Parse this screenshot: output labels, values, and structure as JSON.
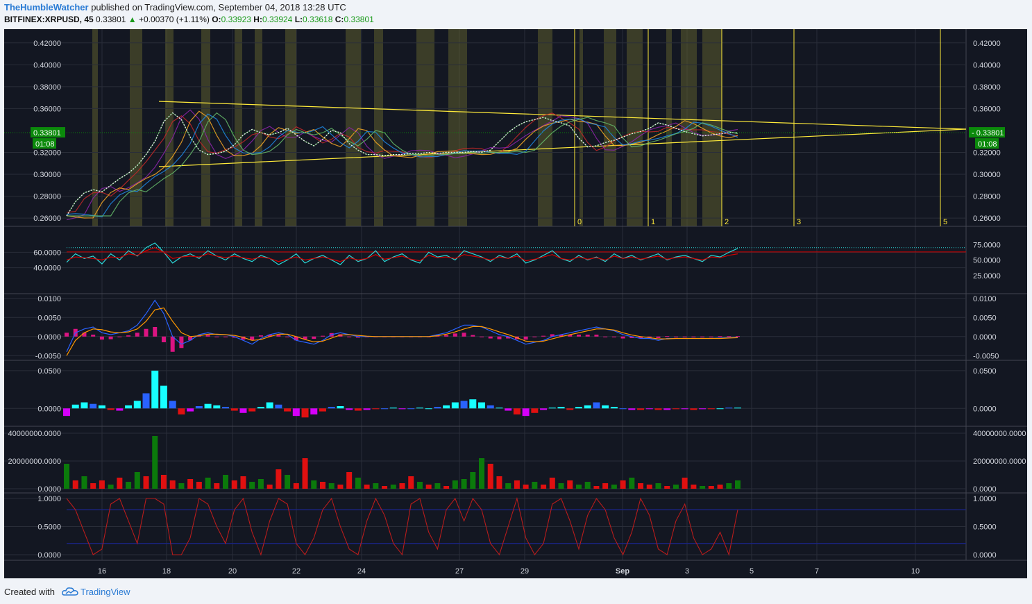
{
  "header": {
    "author": "TheHumbleWatcher",
    "published_text": " published on TradingView.com, September 04, 2018 13:28 UTC",
    "symbol": "BITFINEX:XRPUSD, 45",
    "last": "0.33801",
    "change": "+0.00370 (+1.11%)",
    "o_label": "O:",
    "o_value": "0.33923",
    "h_label": "H:",
    "h_value": "0.33924",
    "l_label": "L:",
    "l_value": "0.33618",
    "c_label": "C:",
    "c_value": "0.33801"
  },
  "footer": {
    "created_with": "Created with",
    "brand": "TradingView"
  },
  "colors": {
    "background": "#131722",
    "grid": "#2a2e39",
    "trendline": "#ffeb3b",
    "highlight_band": "#5c5c2e",
    "price_tag": "#0b8a0b",
    "rsi": "#2bd6d6",
    "rsi_signal": "#d40000",
    "macd": "#2962ff",
    "macd_signal": "#ff9800",
    "macd_hist": "#ff1493",
    "volume_up": "#0b7a0b",
    "volume_down": "#e01010",
    "stoch": "#b71c1c",
    "stoch_bands": "#1a237e"
  },
  "icons": {
    "brand_logo": "tradingview-cloud-icon",
    "trend_arrow": "triangle-up-icon"
  },
  "chart_data": [
    {
      "type": "line",
      "title": "BITFINEX:XRPUSD, 45",
      "x_ticks": [
        "16",
        "18",
        "20",
        "22",
        "24",
        "27",
        "29",
        "Sep",
        "3",
        "5",
        "7",
        "10"
      ],
      "y_ticks": [
        "0.26000",
        "0.28000",
        "0.30000",
        "0.32000",
        "0.36000",
        "0.38000",
        "0.40000",
        "0.42000"
      ],
      "ylim": [
        0.255,
        0.43
      ],
      "series": [
        {
          "values": [
            0.262,
            0.275,
            0.283,
            0.286,
            0.284,
            0.29,
            0.296,
            0.301,
            0.308,
            0.318,
            0.33,
            0.348,
            0.356,
            0.35,
            0.334,
            0.322,
            0.318,
            0.319,
            0.321,
            0.327,
            0.336,
            0.341,
            0.338,
            0.336,
            0.338,
            0.342,
            0.336,
            0.33,
            0.326,
            0.332,
            0.34,
            0.338,
            0.328,
            0.322,
            0.318,
            0.318,
            0.317,
            0.318,
            0.318,
            0.319,
            0.319,
            0.32,
            0.319,
            0.32,
            0.32,
            0.32,
            0.321,
            0.32,
            0.322,
            0.33,
            0.338,
            0.344,
            0.348,
            0.35,
            0.352,
            0.349,
            0.347,
            0.344,
            0.333,
            0.325,
            0.326,
            0.329,
            0.331,
            0.334,
            0.337,
            0.339,
            0.342,
            0.347,
            0.345,
            0.342,
            0.339,
            0.337,
            0.335,
            0.336,
            0.337,
            0.338,
            0.338
          ]
        }
      ],
      "volume_axis_labels": [
        "0",
        "1",
        "2",
        "3",
        "5"
      ],
      "last_price_tag": "0.33801",
      "countdown_tag": "01:08",
      "grid": true
    },
    {
      "type": "line",
      "name": "RSI",
      "y_ticks_left": [
        "40.0000",
        "60.0000"
      ],
      "y_ticks_right": [
        "25.0000",
        "50.0000",
        "75.0000"
      ],
      "ylim": [
        10,
        90
      ],
      "series": [
        {
          "values": [
            47,
            58,
            52,
            55,
            45,
            58,
            50,
            62,
            55,
            66,
            72,
            60,
            46,
            54,
            58,
            52,
            62,
            55,
            50,
            58,
            52,
            48,
            56,
            52,
            44,
            50,
            58,
            46,
            52,
            56,
            50,
            44,
            56,
            48,
            52,
            62,
            48,
            54,
            58,
            50,
            46,
            60,
            54,
            56,
            50,
            62,
            58,
            54,
            48,
            56,
            52,
            58,
            46,
            50,
            56,
            62,
            52,
            48,
            56,
            50,
            54,
            48,
            58,
            52,
            56,
            50,
            54,
            58,
            50,
            54,
            56,
            52,
            48,
            56,
            54,
            60,
            65
          ]
        },
        {
          "values": [
            50,
            54,
            53,
            52,
            50,
            54,
            53,
            58,
            56,
            62,
            66,
            60,
            52,
            54,
            55,
            54,
            58,
            55,
            53,
            55,
            53,
            51,
            54,
            52,
            48,
            51,
            54,
            50,
            52,
            54,
            51,
            48,
            53,
            50,
            52,
            57,
            51,
            53,
            55,
            51,
            49,
            56,
            53,
            54,
            52,
            57,
            55,
            53,
            50,
            54,
            52,
            55,
            49,
            51,
            54,
            57,
            52,
            50,
            54,
            51,
            53,
            50,
            55,
            52,
            54,
            51,
            53,
            55,
            51,
            53,
            54,
            52,
            50,
            54,
            53,
            56,
            58
          ]
        }
      ],
      "levels": [
        70,
        63
      ]
    },
    {
      "type": "line",
      "name": "MACD",
      "y_ticks": [
        "-0.0050",
        "0.0000",
        "0.0050",
        "0.0100"
      ],
      "ylim": [
        -0.0055,
        0.0105
      ],
      "series": [
        {
          "values": [
            -0.004,
            0.001,
            0.002,
            0.0025,
            0.001,
            0.0005,
            0.001,
            0.0015,
            0.003,
            0.006,
            0.0095,
            0.006,
            0.0,
            -0.002,
            -0.001,
            0.0005,
            0.001,
            0.0005,
            0.0005,
            0.0,
            -0.001,
            -0.002,
            -0.0005,
            0.0005,
            0.001,
            0.0005,
            -0.001,
            -0.0015,
            -0.002,
            -0.001,
            0.0005,
            0.001,
            0.0005,
            0.0,
            0.0,
            0.0,
            0.0,
            0.0,
            0.0,
            0.0,
            0.0,
            0.0,
            0.0005,
            0.001,
            0.002,
            0.003,
            0.003,
            0.0025,
            0.0015,
            0.0005,
            0.0,
            -0.001,
            -0.002,
            -0.0015,
            -0.001,
            0.0,
            0.0005,
            0.001,
            0.0015,
            0.002,
            0.0025,
            0.002,
            0.0015,
            0.0005,
            0.0,
            -0.0005,
            -0.0005,
            -0.001,
            -0.0005,
            -0.0005,
            -0.0005,
            -0.0005,
            -0.0005,
            -0.0005,
            -0.0004,
            -0.0003,
            -0.0002
          ]
        },
        {
          "values": [
            -0.005,
            -0.001,
            0.001,
            0.002,
            0.0018,
            0.0012,
            0.001,
            0.0012,
            0.002,
            0.004,
            0.007,
            0.0075,
            0.004,
            0.001,
            0.0,
            0.0002,
            0.0006,
            0.0006,
            0.0005,
            0.0003,
            -0.0002,
            -0.001,
            -0.0008,
            0.0,
            0.0006,
            0.0006,
            0.0,
            -0.0008,
            -0.0014,
            -0.0012,
            -0.0004,
            0.0004,
            0.0005,
            0.0003,
            0.0001,
            0.0,
            0.0,
            0.0,
            0.0,
            0.0,
            0.0,
            0.0,
            0.0002,
            0.0006,
            0.0012,
            0.002,
            0.0026,
            0.0026,
            0.002,
            0.0012,
            0.0005,
            -0.0003,
            -0.0012,
            -0.0014,
            -0.0012,
            -0.0006,
            0.0,
            0.0005,
            0.001,
            0.0015,
            0.002,
            0.002,
            0.0017,
            0.001,
            0.0004,
            0.0,
            -0.0003,
            -0.0006,
            -0.0006,
            -0.0005,
            -0.0005,
            -0.0005,
            -0.0005,
            -0.0005,
            -0.0005,
            -0.0004,
            -0.0003
          ]
        }
      ]
    },
    {
      "type": "bar",
      "name": "Momentum histogram",
      "y_ticks": [
        "0.0000",
        "0.0500"
      ],
      "ylim": [
        -0.02,
        0.06
      ],
      "values": [
        -0.01,
        0.005,
        0.008,
        0.006,
        0.004,
        -0.002,
        -0.003,
        0.004,
        0.01,
        0.02,
        0.05,
        0.03,
        0.01,
        -0.008,
        -0.004,
        0.003,
        0.006,
        0.004,
        0.002,
        -0.003,
        -0.006,
        -0.004,
        0.002,
        0.008,
        0.005,
        -0.004,
        -0.01,
        -0.012,
        -0.008,
        -0.004,
        0.002,
        0.003,
        -0.002,
        -0.003,
        -0.002,
        -0.001,
        0.0,
        0.001,
        -0.001,
        0.0,
        0.001,
        0.0,
        0.002,
        0.004,
        0.008,
        0.01,
        0.012,
        0.008,
        0.004,
        0.001,
        -0.003,
        -0.008,
        -0.01,
        -0.006,
        -0.002,
        0.001,
        0.002,
        -0.002,
        0.002,
        0.004,
        0.008,
        0.004,
        0.002,
        0.0,
        -0.002,
        -0.002,
        -0.001,
        -0.002,
        -0.002,
        -0.001,
        -0.001,
        -0.002,
        -0.001,
        -0.001,
        0.0,
        0.001,
        0.001
      ]
    },
    {
      "type": "bar",
      "name": "Volume",
      "y_ticks": [
        "0.0000",
        "20000000.0000",
        "40000000.0000"
      ],
      "ylim": [
        0,
        42000000
      ],
      "values": [
        18000000,
        6000000,
        9000000,
        4000000,
        6000000,
        3000000,
        8000000,
        5000000,
        12000000,
        9000000,
        38000000,
        10000000,
        6000000,
        4000000,
        7000000,
        5000000,
        8000000,
        4000000,
        10000000,
        6000000,
        9000000,
        5000000,
        7000000,
        3000000,
        14000000,
        10000000,
        4000000,
        22000000,
        6000000,
        5000000,
        4000000,
        3000000,
        12000000,
        8000000,
        3000000,
        4000000,
        2000000,
        3000000,
        4000000,
        9000000,
        5000000,
        3000000,
        4000000,
        2000000,
        6000000,
        7000000,
        12000000,
        22000000,
        18000000,
        9000000,
        4000000,
        6000000,
        3000000,
        5000000,
        3000000,
        8000000,
        4000000,
        6000000,
        3000000,
        5000000,
        2000000,
        4000000,
        3000000,
        6000000,
        8000000,
        4000000,
        3000000,
        4000000,
        2000000,
        3000000,
        8000000,
        3000000,
        2000000,
        2000000,
        3000000,
        4000000,
        6000000
      ],
      "up": [
        true,
        false,
        true,
        false,
        false,
        true,
        false,
        true,
        true,
        false,
        true,
        false,
        false,
        true,
        false,
        false,
        true,
        false,
        true,
        false,
        false,
        true,
        true,
        false,
        false,
        true,
        false,
        false,
        true,
        false,
        true,
        false,
        false,
        true,
        false,
        true,
        false,
        true,
        false,
        false,
        true,
        false,
        true,
        false,
        true,
        true,
        true,
        true,
        false,
        false,
        true,
        false,
        false,
        true,
        false,
        false,
        true,
        false,
        true,
        true,
        false,
        false,
        true,
        false,
        true,
        false,
        false,
        true,
        false,
        true,
        false,
        false,
        true,
        false,
        false,
        true,
        true
      ]
    },
    {
      "type": "line",
      "name": "Stochastic",
      "y_ticks": [
        "0.0000",
        "0.5000",
        "1.0000"
      ],
      "ylim": [
        -0.05,
        1.05
      ],
      "series": [
        {
          "values": [
            1.0,
            0.8,
            0.4,
            0.0,
            0.1,
            0.9,
            1.0,
            0.6,
            0.2,
            1.0,
            1.0,
            0.9,
            0.0,
            0.0,
            0.3,
            1.0,
            0.9,
            0.5,
            0.2,
            0.8,
            1.0,
            0.4,
            0.0,
            0.6,
            1.0,
            0.9,
            0.2,
            0.0,
            0.3,
            0.8,
            1.0,
            0.5,
            0.1,
            0.0,
            0.6,
            1.0,
            0.7,
            0.2,
            0.0,
            0.9,
            1.0,
            0.4,
            0.1,
            0.8,
            1.0,
            0.6,
            1.0,
            0.8,
            0.2,
            0.0,
            0.5,
            1.0,
            0.3,
            0.0,
            0.2,
            0.9,
            1.0,
            0.6,
            0.1,
            0.7,
            1.0,
            0.8,
            0.3,
            0.0,
            0.4,
            1.0,
            0.7,
            0.1,
            0.0,
            0.6,
            0.9,
            0.3,
            0.0,
            0.1,
            0.4,
            0.0,
            0.8
          ]
        }
      ],
      "levels": [
        0.8,
        0.2
      ]
    }
  ]
}
